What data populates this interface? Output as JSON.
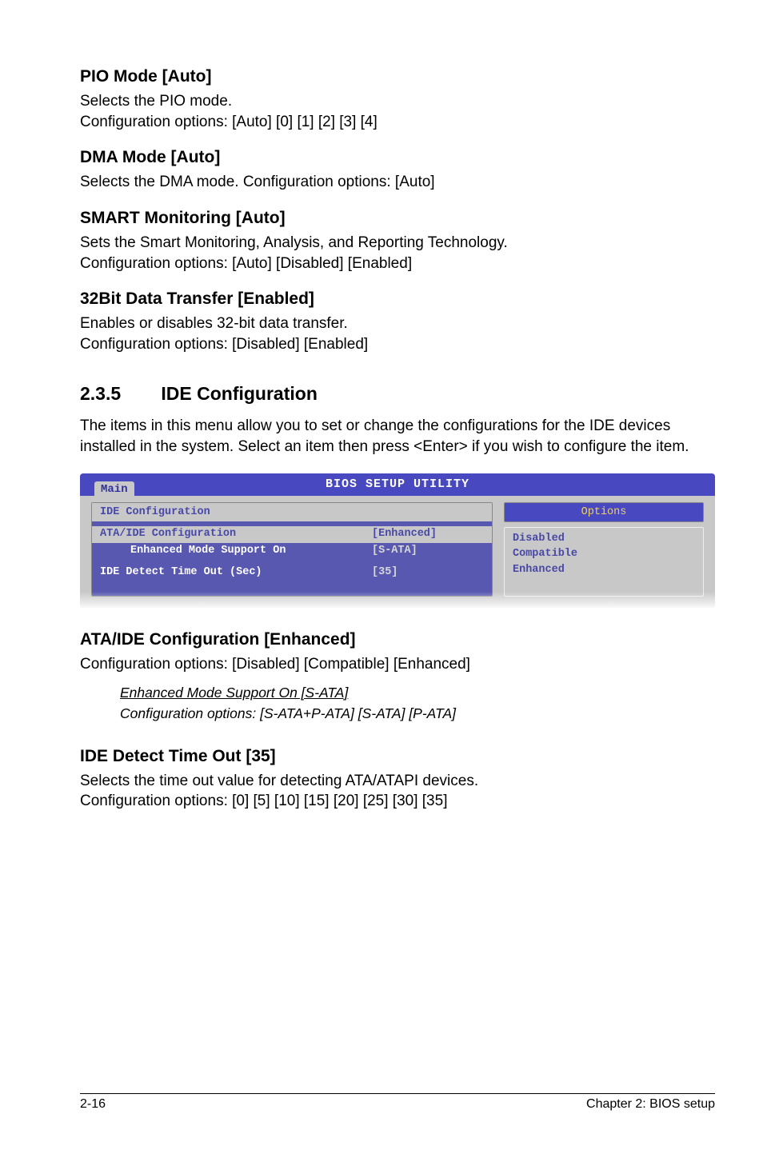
{
  "sections": {
    "pio": {
      "heading": "PIO Mode [Auto]",
      "line1": "Selects the PIO mode.",
      "line2": "Configuration options: [Auto] [0] [1] [2] [3] [4]"
    },
    "dma": {
      "heading": "DMA Mode [Auto]",
      "body": "Selects the DMA mode. Configuration options: [Auto]"
    },
    "smart": {
      "heading": "SMART Monitoring [Auto]",
      "line1": "Sets the Smart Monitoring, Analysis, and Reporting Technology.",
      "line2": "Configuration options: [Auto] [Disabled] [Enabled]"
    },
    "bit32": {
      "heading": "32Bit Data Transfer [Enabled]",
      "line1": "Enables or disables 32-bit data transfer.",
      "line2": "Configuration options: [Disabled] [Enabled]"
    },
    "ide": {
      "num": "2.3.5",
      "title": "IDE Configuration",
      "body": "The items in this menu allow you to set or change the configurations for the IDE devices installed in the system. Select an item then press <Enter> if you wish to configure the item."
    },
    "ataide": {
      "heading": "ATA/IDE Configuration [Enhanced]",
      "body": "Configuration options: [Disabled] [Compatible] [Enhanced]",
      "sub1": "Enhanced Mode Support On [S-ATA]",
      "sub2": "Configuration options: [S-ATA+P-ATA] [S-ATA] [P-ATA]"
    },
    "timeout": {
      "heading": "IDE Detect Time Out [35]",
      "line1": "Selects the time out value for detecting ATA/ATAPI devices.",
      "line2": "Configuration options: [0] [5] [10] [15] [20] [25] [30] [35]"
    }
  },
  "bios": {
    "title": "BIOS SETUP UTILITY",
    "tab": "Main",
    "panel_header": "IDE Configuration",
    "rows": {
      "r1": {
        "label": "ATA/IDE Configuration",
        "value": "[Enhanced]"
      },
      "r2": {
        "label": "Enhanced Mode Support On",
        "value": "[S-ATA]"
      },
      "r3": {
        "label": "IDE Detect Time Out (Sec)",
        "value": "[35]"
      }
    },
    "options_header": "Options",
    "options": {
      "o1": "Disabled",
      "o2": "Compatible",
      "o3": "Enhanced"
    }
  },
  "footer": {
    "left": "2-16",
    "right": "Chapter 2: BIOS setup"
  }
}
